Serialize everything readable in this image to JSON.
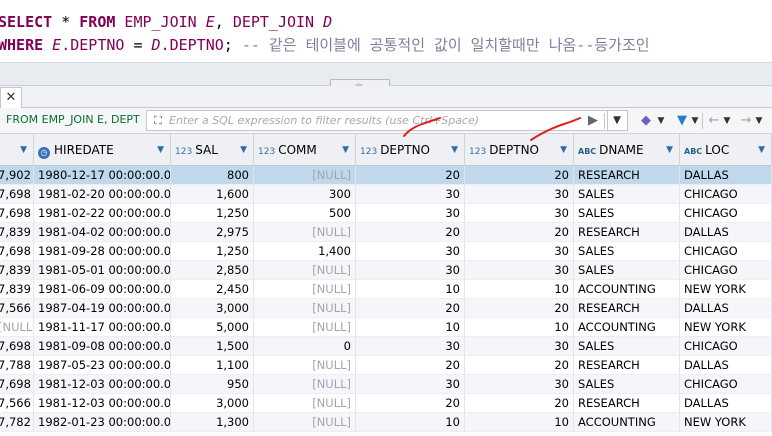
{
  "editor": {
    "line1": {
      "kw1": "SELECT",
      "star": " * ",
      "kw2": "FROM",
      "t1": " EMP_JOIN",
      "a1": " E",
      "comma": ", ",
      "t2": "DEPT_JOIN",
      "a2": " D"
    },
    "line2": {
      "kw1": "WHERE",
      "a1": " E",
      "c1": ".DEPTNO",
      "eq": " = ",
      "a2": "D",
      "c2": ".DEPTNO",
      "semi": ";",
      "comment": " -- 같은 테이블에 공통적인 값이 일치할때만 나옴--등가조인"
    }
  },
  "sash": {
    "icon": "collapse-up-icon"
  },
  "tab": {
    "close_icon": "close-icon",
    "close": "✕"
  },
  "filter": {
    "source_label": "FROM EMP_JOIN E, DEPT",
    "placeholder": "Enter a SQL expression to filter results (use Ctrl+Space)",
    "value": ""
  },
  "columns": [
    {
      "key": "c0",
      "label": "",
      "tag": ""
    },
    {
      "key": "hiredate",
      "label": "HIREDATE",
      "tag": "clock"
    },
    {
      "key": "sal",
      "label": "SAL",
      "tag": "123"
    },
    {
      "key": "comm",
      "label": "COMM",
      "tag": "123"
    },
    {
      "key": "deptno1",
      "label": "DEPTNO",
      "tag": "123"
    },
    {
      "key": "deptno2",
      "label": "DEPTNO",
      "tag": "123"
    },
    {
      "key": "dname",
      "label": "DNAME",
      "tag": "ABC"
    },
    {
      "key": "loc",
      "label": "LOC",
      "tag": "ABC"
    }
  ],
  "rows": [
    [
      "7,902",
      "1980-12-17 00:00:00.000",
      "800",
      "[NULL]",
      "20",
      "20",
      "RESEARCH",
      "DALLAS"
    ],
    [
      "7,698",
      "1981-02-20 00:00:00.000",
      "1,600",
      "300",
      "30",
      "30",
      "SALES",
      "CHICAGO"
    ],
    [
      "7,698",
      "1981-02-22 00:00:00.000",
      "1,250",
      "500",
      "30",
      "30",
      "SALES",
      "CHICAGO"
    ],
    [
      "7,839",
      "1981-04-02 00:00:00.000",
      "2,975",
      "[NULL]",
      "20",
      "20",
      "RESEARCH",
      "DALLAS"
    ],
    [
      "7,698",
      "1981-09-28 00:00:00.000",
      "1,250",
      "1,400",
      "30",
      "30",
      "SALES",
      "CHICAGO"
    ],
    [
      "7,839",
      "1981-05-01 00:00:00.000",
      "2,850",
      "[NULL]",
      "30",
      "30",
      "SALES",
      "CHICAGO"
    ],
    [
      "7,839",
      "1981-06-09 00:00:00.000",
      "2,450",
      "[NULL]",
      "10",
      "10",
      "ACCOUNTING",
      "NEW YORK"
    ],
    [
      "7,566",
      "1987-04-19 00:00:00.000",
      "3,000",
      "[NULL]",
      "20",
      "20",
      "RESEARCH",
      "DALLAS"
    ],
    [
      "[NULL]",
      "1981-11-17 00:00:00.000",
      "5,000",
      "[NULL]",
      "10",
      "10",
      "ACCOUNTING",
      "NEW YORK"
    ],
    [
      "7,698",
      "1981-09-08 00:00:00.000",
      "1,500",
      "0",
      "30",
      "30",
      "SALES",
      "CHICAGO"
    ],
    [
      "7,788",
      "1987-05-23 00:00:00.000",
      "1,100",
      "[NULL]",
      "20",
      "20",
      "RESEARCH",
      "DALLAS"
    ],
    [
      "7,698",
      "1981-12-03 00:00:00.000",
      "950",
      "[NULL]",
      "30",
      "30",
      "SALES",
      "CHICAGO"
    ],
    [
      "7,566",
      "1981-12-03 00:00:00.000",
      "3,000",
      "[NULL]",
      "20",
      "20",
      "RESEARCH",
      "DALLAS"
    ],
    [
      "7,782",
      "1982-01-23 00:00:00.000",
      "1,300",
      "[NULL]",
      "10",
      "10",
      "ACCOUNTING",
      "NEW YORK"
    ]
  ],
  "colors": {
    "keyword": "#7f0055",
    "comment": "#7f7f9f",
    "selected_row": "#bfd8ec",
    "annotation": "#e02020",
    "null_text": "#a2a6ab"
  }
}
